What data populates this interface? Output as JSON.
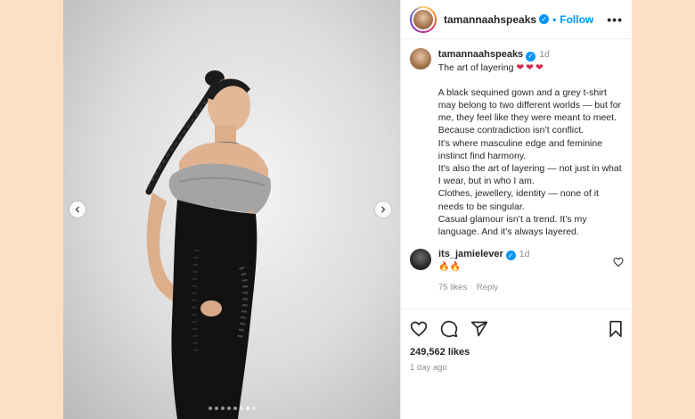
{
  "post": {
    "username": "tamannaahspeaks",
    "follow_label": "Follow",
    "more_label": "•••",
    "verified_glyph": "✓"
  },
  "caption": {
    "username": "tamannaahspeaks",
    "time": "1d",
    "title": "The art of layering",
    "hearts": "❤❤❤",
    "paragraph1": "A black sequined gown and a grey t-shirt may belong to two different worlds — but for me, they feel like they were meant to meet.",
    "lines": [
      "Because contradiction isn’t conflict.",
      "It’s where masculine edge and feminine instinct find harmony.",
      "It’s also the art of layering — not just in what I wear, but in who I am.",
      "Clothes, jewellery, identity — none of it needs to be singular.",
      "Casual glamour isn’t a trend. It’s my language. And it’s always layered."
    ]
  },
  "comment": {
    "username": "its_jamielever",
    "time": "1d",
    "text": "🔥🔥",
    "likes": "75 likes",
    "reply": "Reply"
  },
  "footer": {
    "likes": "249,562 likes",
    "date": "1 day ago"
  },
  "carousel": {
    "dot_count": 8,
    "active_index": 6
  },
  "colors": {
    "page_bg": "#fde0c4",
    "accent": "#0095f6",
    "heart": "#d62a4d"
  }
}
